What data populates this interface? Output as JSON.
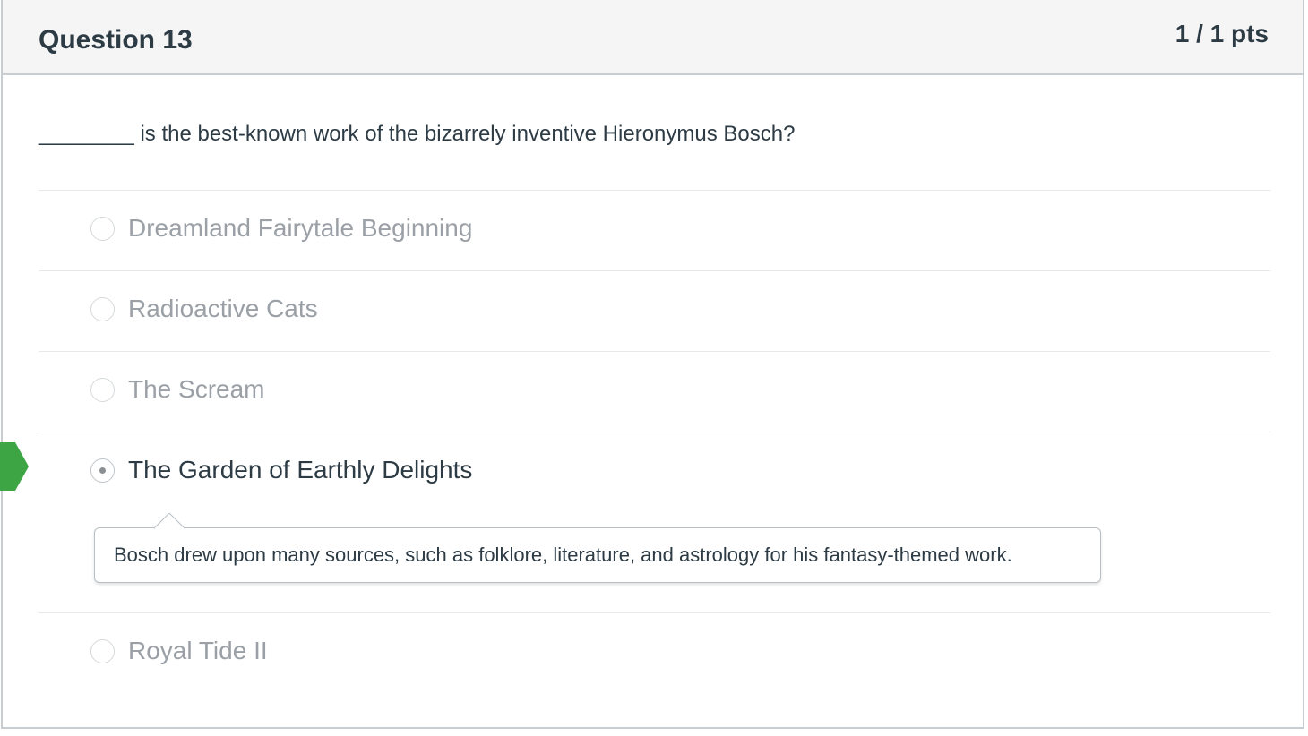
{
  "question": {
    "title": "Question 13",
    "points": "1 / 1 pts",
    "text": "________ is the best-known work of the bizarrely inventive Hieronymus Bosch?"
  },
  "answers": [
    {
      "label": "Dreamland Fairytale Beginning",
      "selected": false
    },
    {
      "label": "Radioactive Cats",
      "selected": false
    },
    {
      "label": "The Scream",
      "selected": false
    },
    {
      "label": "The Garden of Earthly Delights",
      "selected": true
    },
    {
      "label": "Royal Tide II",
      "selected": false
    }
  ],
  "comment": {
    "text": "Bosch drew upon many sources, such as folklore, literature, and astrology for his fantasy-themed work."
  },
  "colors": {
    "correct_marker": "#3da544",
    "header_bg": "#f5f5f5",
    "text": "#2d3b45",
    "muted_text": "#9aa0a6"
  },
  "icons": {
    "correct_marker": "correct-answer-arrow-icon",
    "radio": "radio-icon"
  }
}
